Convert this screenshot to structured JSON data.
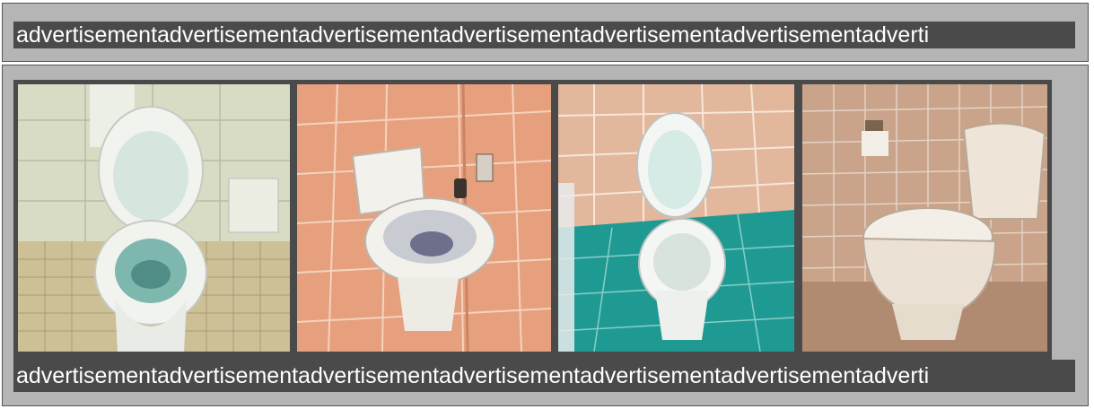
{
  "top_banner": {
    "ad_text": "advertisementadvertisementadvertisementadvertisementadvertisementadvertisementadverti"
  },
  "gallery": {
    "images": [
      {
        "subject": "toilet",
        "tile_color": "#d9dcc4",
        "floor_color": "#cdbf96",
        "icon": "toilet-image"
      },
      {
        "subject": "toilet",
        "tile_color": "#e6a07e",
        "floor_color": "#e2a484",
        "icon": "toilet-image"
      },
      {
        "subject": "toilet",
        "tile_color": "#e2b79c",
        "floor_color": "#1f9a93",
        "icon": "toilet-image"
      },
      {
        "subject": "toilet",
        "tile_color": "#c9a48a",
        "floor_color": "#b08b72",
        "icon": "toilet-image"
      }
    ]
  },
  "bottom_banner": {
    "ad_text": "advertisementadvertisementadvertisementadvertisementadvertisementadvertisementadverti"
  }
}
